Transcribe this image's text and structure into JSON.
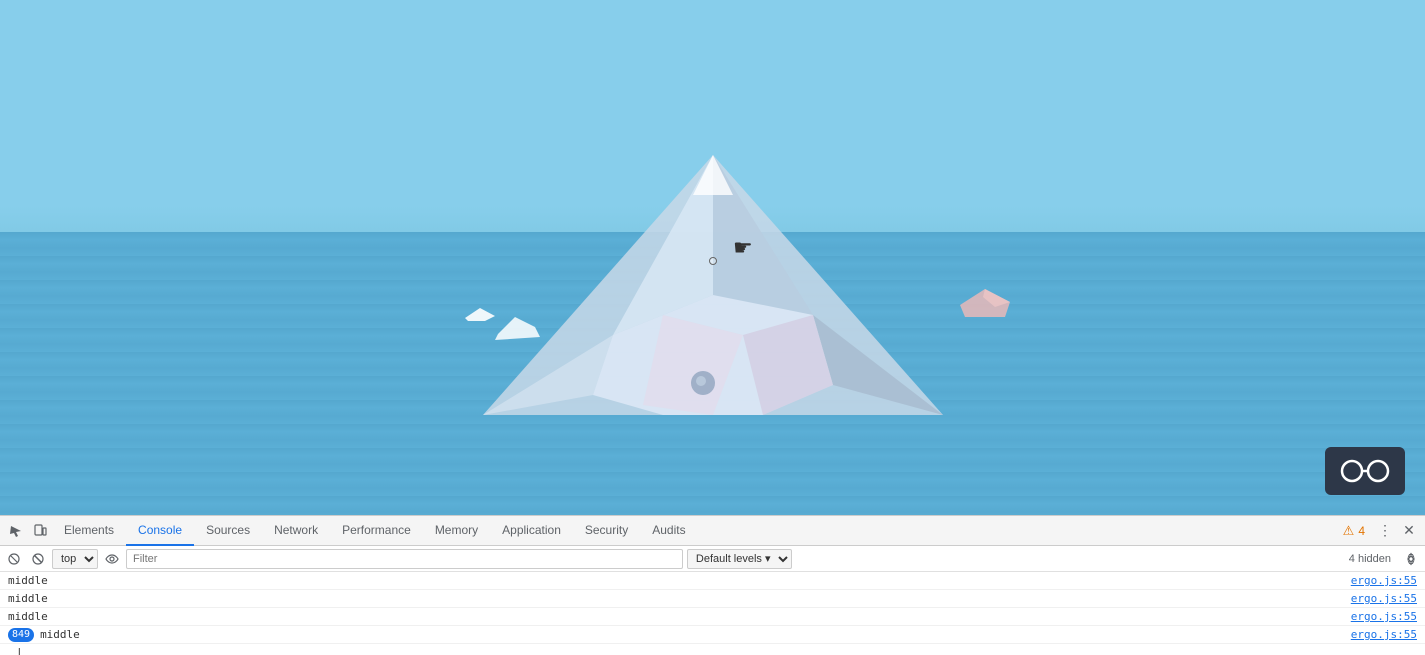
{
  "viewport": {
    "background_sky": "#87CEEB",
    "background_ocean": "#5BAFD6"
  },
  "vr_button": {
    "label": "VR"
  },
  "devtools": {
    "tabs": [
      {
        "label": "Elements",
        "active": false
      },
      {
        "label": "Console",
        "active": true
      },
      {
        "label": "Sources",
        "active": false
      },
      {
        "label": "Network",
        "active": false
      },
      {
        "label": "Performance",
        "active": false
      },
      {
        "label": "Memory",
        "active": false
      },
      {
        "label": "Application",
        "active": false
      },
      {
        "label": "Security",
        "active": false
      },
      {
        "label": "Audits",
        "active": false
      }
    ],
    "warning_count": "4",
    "hidden_count": "4 hidden",
    "console_toolbar": {
      "context": "top",
      "filter_placeholder": "Filter",
      "levels": "Default levels"
    },
    "log_rows": [
      {
        "text": "middle",
        "source": "ergo.js:55",
        "badge": null
      },
      {
        "text": "middle",
        "source": "ergo.js:55",
        "badge": null
      },
      {
        "text": "middle",
        "source": "ergo.js:55",
        "badge": null
      },
      {
        "text": "middle",
        "source": "ergo.js:55",
        "badge": "849"
      }
    ],
    "cursor_line": "|"
  }
}
